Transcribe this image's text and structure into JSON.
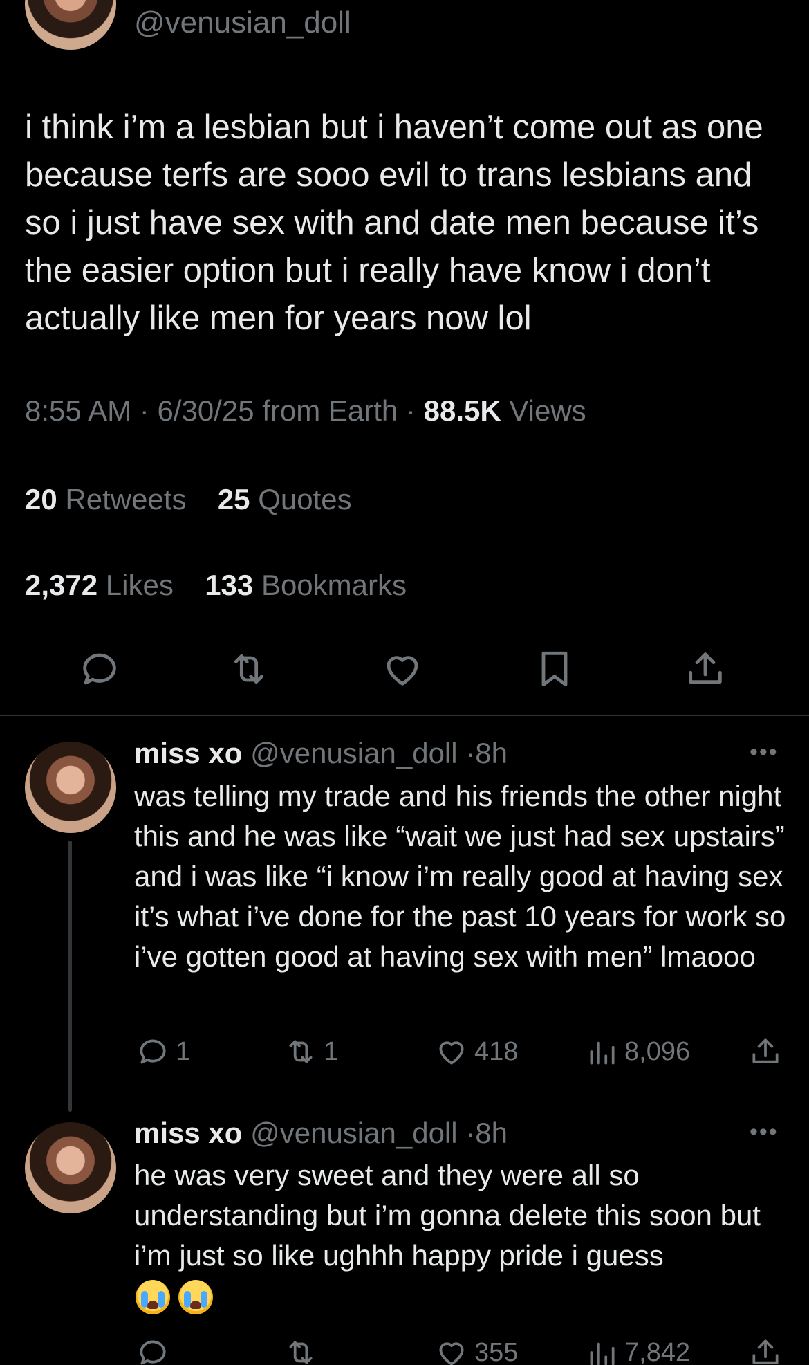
{
  "main_tweet": {
    "handle": "@venusian_doll",
    "text": "i think i’m a lesbian but i haven’t come out as one because terfs are sooo evil to trans lesbians and so i just have sex with and date men because it’s the easier option but i really have know i don’t actually like men for years now lol",
    "time": "8:55 AM",
    "date_source": "6/30/25 from Earth",
    "views_count": "88.5K",
    "views_label": "Views",
    "retweets_count": "20",
    "retweets_label": "Retweets",
    "quotes_count": "25",
    "quotes_label": "Quotes",
    "likes_count": "2,372",
    "likes_label": "Likes",
    "bookmarks_count": "133",
    "bookmarks_label": "Bookmarks",
    "actions": [
      "reply-icon",
      "retweet-icon",
      "like-icon",
      "bookmark-icon",
      "share-icon"
    ]
  },
  "replies": [
    {
      "name": "miss xo",
      "handle": "@venusian_doll",
      "age": "8h",
      "text": "was telling my trade and his friends the other night this and he was like “wait we just had sex upstairs” and i was like “i know i’m really good at having sex it’s what i’ve done for the past 10 years for work so i’ve gotten good at having sex with men” lmaooo",
      "replies": "1",
      "retweets": "1",
      "likes": "418",
      "views": "8,096"
    },
    {
      "name": "miss xo",
      "handle": "@venusian_doll",
      "age": "8h",
      "text": "he was very sweet and they were all so understanding but i’m gonna delete this soon but i’m just so like ughhh happy pride i guess",
      "emoji": "😭 😭",
      "replies": "",
      "retweets": "",
      "likes": "355",
      "views": "7,842"
    }
  ],
  "colors": {
    "background": "#000000",
    "primary_text": "#e7e9ea",
    "secondary_text": "#71767b",
    "divider": "#2f3336"
  }
}
